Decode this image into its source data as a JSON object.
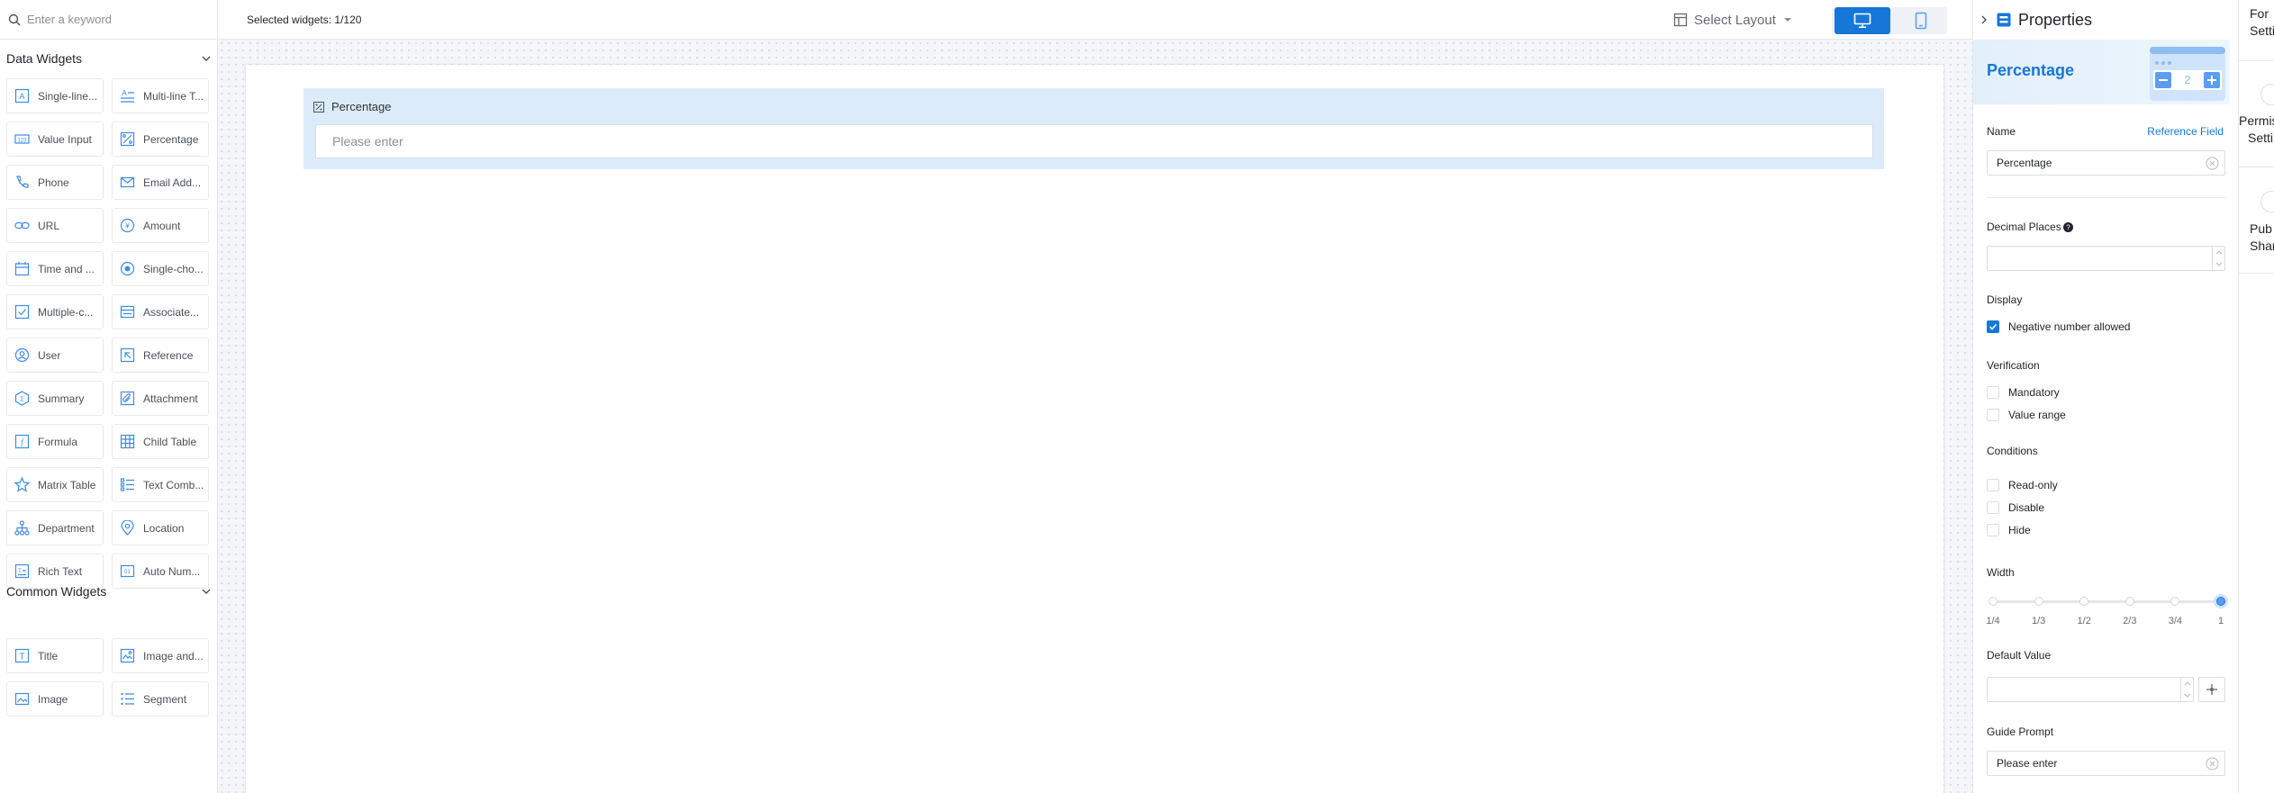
{
  "search": {
    "placeholder": "Enter a keyword"
  },
  "data_widgets": {
    "title": "Data Widgets",
    "items": [
      {
        "label": "Single-line...",
        "icon": "single-line-text-icon"
      },
      {
        "label": "Multi-line T...",
        "icon": "multi-line-text-icon"
      },
      {
        "label": "Value Input",
        "icon": "value-input-icon"
      },
      {
        "label": "Percentage",
        "icon": "percentage-icon"
      },
      {
        "label": "Phone",
        "icon": "phone-icon"
      },
      {
        "label": "Email Add...",
        "icon": "email-icon"
      },
      {
        "label": "URL",
        "icon": "link-icon"
      },
      {
        "label": "Amount",
        "icon": "amount-icon"
      },
      {
        "label": "Time and ...",
        "icon": "calendar-icon"
      },
      {
        "label": "Single-cho...",
        "icon": "radio-icon"
      },
      {
        "label": "Multiple-c...",
        "icon": "checkbox-icon"
      },
      {
        "label": "Associate...",
        "icon": "associate-icon"
      },
      {
        "label": "User",
        "icon": "user-icon"
      },
      {
        "label": "Reference",
        "icon": "reference-icon"
      },
      {
        "label": "Summary",
        "icon": "summary-icon"
      },
      {
        "label": "Attachment",
        "icon": "attachment-icon"
      },
      {
        "label": "Formula",
        "icon": "formula-icon"
      },
      {
        "label": "Child Table",
        "icon": "child-table-icon"
      },
      {
        "label": "Matrix Table",
        "icon": "matrix-table-icon"
      },
      {
        "label": "Text Comb...",
        "icon": "text-combination-icon"
      },
      {
        "label": "Department",
        "icon": "department-icon"
      },
      {
        "label": "Location",
        "icon": "location-pin-icon"
      },
      {
        "label": "Rich Text",
        "icon": "rich-text-icon"
      },
      {
        "label": "Auto Num...",
        "icon": "auto-number-icon"
      }
    ]
  },
  "common_widgets": {
    "title": "Common Widgets",
    "items": [
      {
        "label": "Title",
        "icon": "title-icon"
      },
      {
        "label": "Image and...",
        "icon": "image-and-text-icon"
      },
      {
        "label": "Image",
        "icon": "image-icon"
      },
      {
        "label": "Segment",
        "icon": "segment-icon"
      }
    ]
  },
  "toolbar": {
    "selected_text": "Selected widgets: 1/120",
    "layout_label": "Select Layout"
  },
  "canvas": {
    "widget_label": "Percentage",
    "widget_placeholder": "Please enter"
  },
  "properties": {
    "title": "Properties",
    "type_title": "Percentage",
    "illus_value": "2",
    "name_label": "Name",
    "reference_field": "Reference Field",
    "name_value": "Percentage",
    "decimal_label": "Decimal Places",
    "display_label": "Display",
    "negative_allowed": "Negative number allowed",
    "negative_checked": true,
    "verification_label": "Verification",
    "mandatory": "Mandatory",
    "value_range": "Value range",
    "conditions_label": "Conditions",
    "read_only": "Read-only",
    "disable": "Disable",
    "hide": "Hide",
    "width_label": "Width",
    "width_options": [
      "1/4",
      "1/3",
      "1/2",
      "2/3",
      "3/4",
      "1"
    ],
    "width_selected": "1",
    "default_value_label": "Default Value",
    "guide_prompt_label": "Guide Prompt",
    "guide_prompt_value": "Please enter"
  },
  "side_strip": {
    "form_settings": [
      "For",
      "Setti"
    ],
    "permission_settings": [
      "Permis",
      "Setti"
    ],
    "publish_share": [
      "Pub",
      "Shar"
    ]
  },
  "colors": {
    "accent": "#1677d9",
    "selected_bg": "#dcebf9",
    "canvas_bg": "#f4f6f9"
  }
}
